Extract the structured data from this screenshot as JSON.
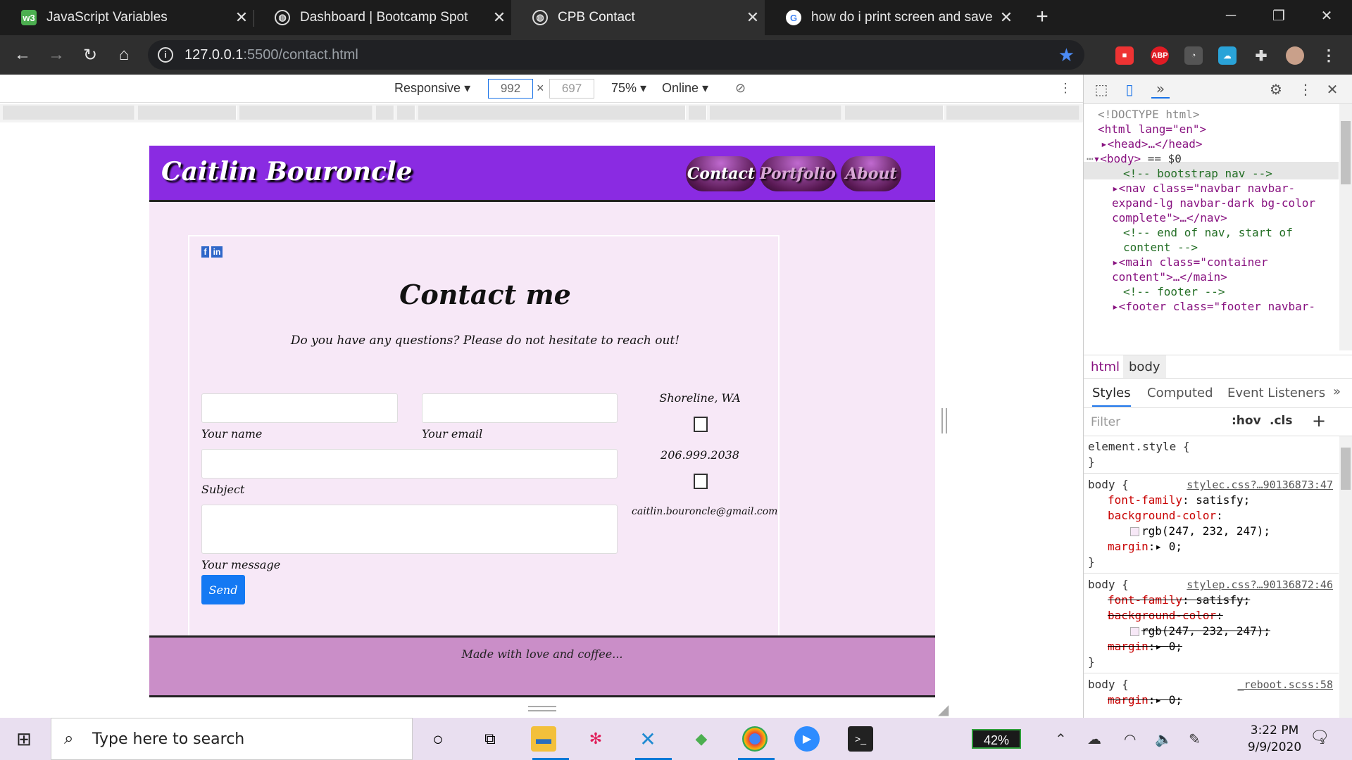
{
  "tabs": [
    {
      "label": "JavaScript Variables",
      "icon": "w3schools-icon"
    },
    {
      "label": "Dashboard | Bootcamp Spot",
      "icon": "globe-icon"
    },
    {
      "label": "CPB Contact",
      "icon": "globe-icon"
    },
    {
      "label": "how do i print screen and save to",
      "icon": "google-icon"
    }
  ],
  "address": {
    "host": "127.0.0.1",
    "rest": ":5500/contact.html"
  },
  "extensions": [
    "ABP"
  ],
  "device_toolbar": {
    "mode": "Responsive",
    "width": "992",
    "height": "697",
    "zoom": "75%",
    "network": "Online"
  },
  "page": {
    "brand": "Caitlin Bouroncle",
    "nav": [
      "Contact",
      "Portfolio",
      "About"
    ],
    "social": [
      "f",
      "in"
    ],
    "title": "Contact me",
    "subtitle": "Do you have any questions? Please do not hesitate to reach out!",
    "labels": {
      "name": "Your name",
      "email": "Your email",
      "subject": "Subject",
      "message": "Your message"
    },
    "send": "Send",
    "contact": {
      "location": "Shoreline, WA",
      "phone": "206.999.2038",
      "email": "caitlin.bouroncle@gmail.com"
    },
    "footer": "Made with love and coffee..."
  },
  "devtools": {
    "elements": {
      "doctype": "<!DOCTYPE html>",
      "html_open": "<html lang=\"en\">",
      "head": "<head>…</head>",
      "body": "<body>",
      "body_eq": "== $0",
      "c1": "<!-- bootstrap nav -->",
      "nav1": "<nav class=\"navbar navbar-",
      "nav2": "expand-lg navbar-dark bg-color",
      "nav3": "complete\">…</nav>",
      "c2": "<!-- end of nav, start of",
      "c2b": "content -->",
      "main1": "<main class=\"container",
      "main2": "content\">…</main>",
      "c3": "<!-- footer -->",
      "footer1": "<footer class=\"footer navbar-"
    },
    "breadcrumb": [
      "html",
      "body"
    ],
    "subtabs": [
      "Styles",
      "Computed",
      "Event Listeners"
    ],
    "filter_placeholder": "Filter",
    "filter_btns": [
      ":hov",
      ".cls"
    ],
    "rules": {
      "element_style": "element.style {",
      "close": "}",
      "body_sel": "body {",
      "src1": "stylec.css?…90136873:47",
      "src2": "stylep.css?…90136872:46",
      "src3": "_reboot.scss:58",
      "ff_prop": "font-family",
      "ff_val": "satisfy;",
      "bg_prop": "background-color",
      "bg_val": "rgb(247, 232, 247);",
      "margin_prop": "margin",
      "margin_val": "0;"
    }
  },
  "taskbar": {
    "search": "Type here to search",
    "battery": "42%",
    "time": "3:22 PM",
    "date": "9/9/2020",
    "notifications": "1"
  }
}
